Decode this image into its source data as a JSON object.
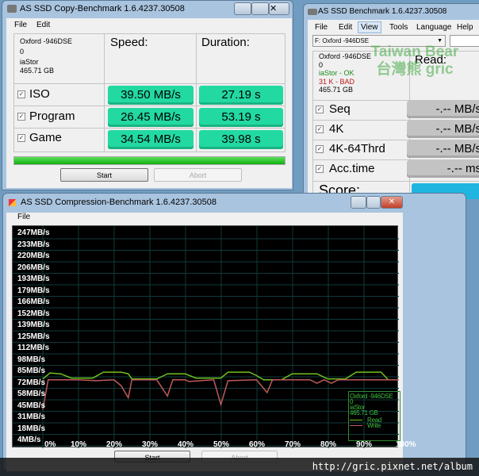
{
  "copy_window": {
    "title": "AS SSD Copy-Benchmark 1.6.4237.30508",
    "menu": [
      "File",
      "Edit"
    ],
    "drive": {
      "name": "Oxford -946DSE",
      "id": "0",
      "driver": "iaStor",
      "size": "465.71 GB"
    },
    "headers": {
      "speed": "Speed:",
      "duration": "Duration:"
    },
    "rows": [
      {
        "label": "ISO",
        "speed": "39.50 MB/s",
        "duration": "27.19 s",
        "checked": true
      },
      {
        "label": "Program",
        "speed": "26.45 MB/s",
        "duration": "53.19 s",
        "checked": true
      },
      {
        "label": "Game",
        "speed": "34.54 MB/s",
        "duration": "39.98 s",
        "checked": true
      }
    ],
    "progress": 100,
    "start": "Start",
    "abort": "Abort"
  },
  "main_window": {
    "title": "AS SSD Benchmark 1.6.4237.30508",
    "menu": [
      "File",
      "Edit",
      "View",
      "Tools",
      "Language",
      "Help"
    ],
    "drive_select": "F: Oxford -946DSE",
    "drive": {
      "name": "Oxford -946DSE",
      "id": "0",
      "driver_status": "iaStor - OK",
      "align_status": "31 K - BAD",
      "size": "465.71 GB"
    },
    "read_header": "Read:",
    "rows": [
      {
        "label": "Seq",
        "value": "-.-- MB/s"
      },
      {
        "label": "4K",
        "value": "-.-- MB/s"
      },
      {
        "label": "4K-64Thrd",
        "value": "-.-- MB/s"
      },
      {
        "label": "Acc.time",
        "value": "-.-- ms"
      }
    ],
    "score": "Score:"
  },
  "watermark": {
    "line1": "Taiwan Bear",
    "line2": "台灣熊 gric"
  },
  "compression_window": {
    "title": "AS SSD Compression-Benchmark 1.6.4237.30508",
    "menu": [
      "File"
    ],
    "start": "Start",
    "abort": "Abort"
  },
  "chart_data": {
    "type": "line",
    "y_ticks": [
      "247MB/s",
      "233MB/s",
      "220MB/s",
      "206MB/s",
      "193MB/s",
      "179MB/s",
      "166MB/s",
      "152MB/s",
      "139MB/s",
      "125MB/s",
      "112MB/s",
      "98MB/s",
      "85MB/s",
      "72MB/s",
      "58MB/s",
      "45MB/s",
      "31MB/s",
      "18MB/s",
      "4MB/s"
    ],
    "x_ticks": [
      "0%",
      "10%",
      "20%",
      "30%",
      "40%",
      "50%",
      "60%",
      "70%",
      "80%",
      "90%",
      "100%"
    ],
    "ylim": [
      4,
      247
    ],
    "xlim": [
      0,
      100
    ],
    "legend": {
      "drive": "Oxford -946DSE",
      "id": "0",
      "driver": "iaStor",
      "size": "465.71 GB",
      "placement": "bottom-right"
    },
    "series": [
      {
        "name": "Read",
        "color": "#6fc21a",
        "x": [
          0,
          2,
          5,
          8,
          14,
          17,
          22,
          24,
          25,
          32,
          34,
          35,
          40,
          43,
          50,
          52,
          58,
          60,
          62,
          67,
          70,
          77,
          80,
          85,
          88,
          95,
          97,
          100
        ],
        "y": [
          76,
          83,
          82,
          77,
          77,
          84,
          84,
          82,
          76,
          76,
          80,
          82,
          82,
          77,
          77,
          84,
          84,
          80,
          75,
          75,
          82,
          82,
          76,
          76,
          84,
          84,
          75,
          75
        ]
      },
      {
        "name": "Write",
        "color": "#c05a5a",
        "x": [
          0,
          1.5,
          10,
          15,
          20,
          22,
          24,
          25,
          32,
          35,
          36.5,
          40,
          41,
          48,
          50,
          52,
          60,
          63,
          64.5,
          75,
          77,
          79,
          81,
          83,
          100
        ],
        "y": [
          40,
          75,
          75,
          74,
          75,
          68,
          54,
          75,
          75,
          56,
          75,
          75,
          73,
          75,
          46,
          74,
          75,
          60,
          75,
          75,
          71,
          75,
          71,
          75,
          75
        ]
      }
    ]
  },
  "footer_url": "http://gric.pixnet.net/album"
}
